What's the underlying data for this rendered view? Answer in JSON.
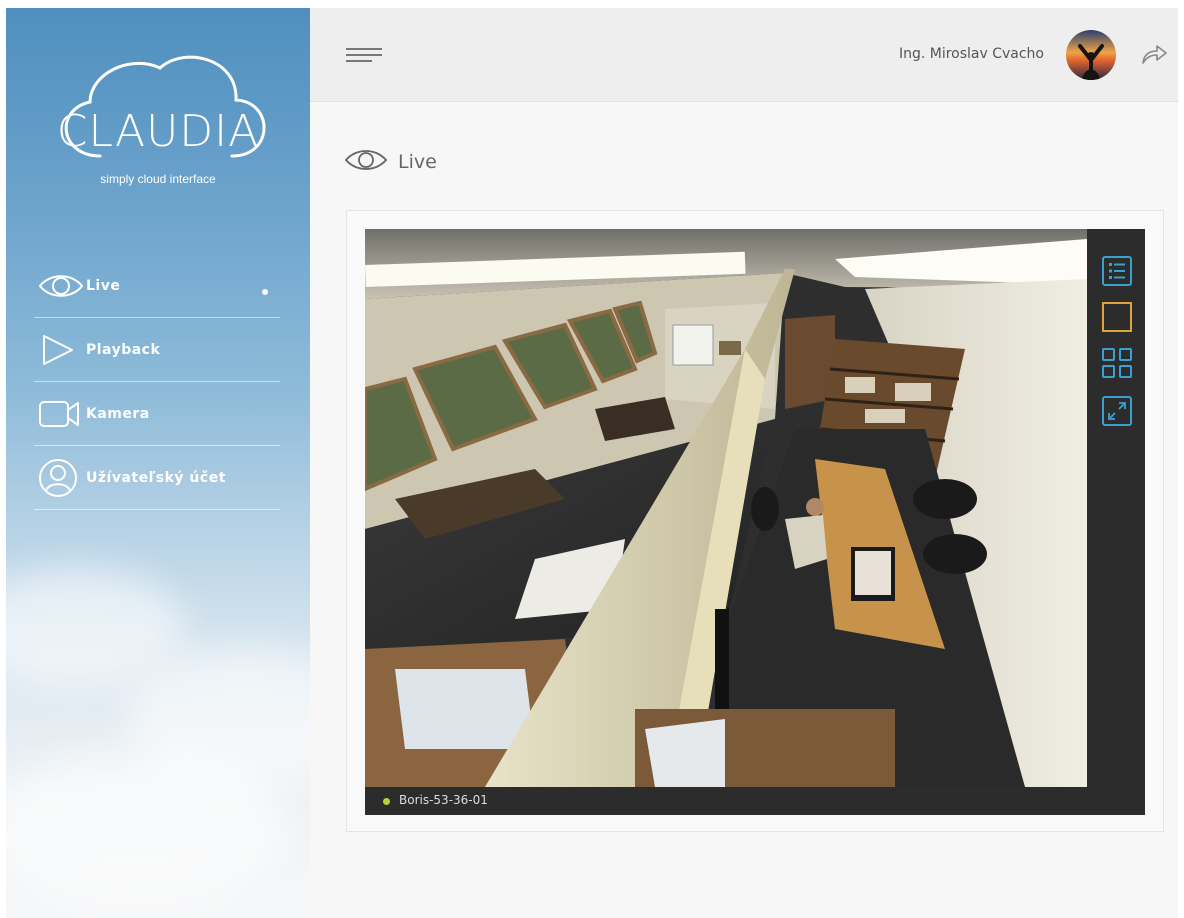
{
  "brand": {
    "logo_text": "CLAUDIA",
    "tagline": "simply cloud interface"
  },
  "nav": {
    "items": [
      {
        "label": "Live",
        "icon": "eye-icon",
        "active": true
      },
      {
        "label": "Playback",
        "icon": "play-icon",
        "active": false
      },
      {
        "label": "Kamera",
        "icon": "video-camera-icon",
        "active": false
      },
      {
        "label": "Užívateľský účet",
        "icon": "user-icon",
        "active": false
      }
    ]
  },
  "topbar": {
    "user_name": "Ing. Miroslav Cvacho",
    "menu_icon": "hamburger-icon",
    "logout_icon": "share-arrow-icon"
  },
  "page": {
    "title": "Live",
    "title_icon": "eye-icon"
  },
  "viewer": {
    "camera_name": "Boris-53-36-01",
    "status": "online",
    "status_color": "#b8d430",
    "tools": [
      {
        "icon": "list-icon",
        "color": "#3aa0d0"
      },
      {
        "icon": "single-view-icon",
        "color": "#e0a23a",
        "selected": true
      },
      {
        "icon": "grid-2x2-icon",
        "color": "#3aa0d0"
      },
      {
        "icon": "fullscreen-icon",
        "color": "#3aa0d0"
      }
    ]
  },
  "colors": {
    "sidebar_top": "#4f8fbf",
    "accent": "#3aa0d0",
    "selected_tool": "#e0a23a",
    "topbar": "#eeeeee"
  }
}
